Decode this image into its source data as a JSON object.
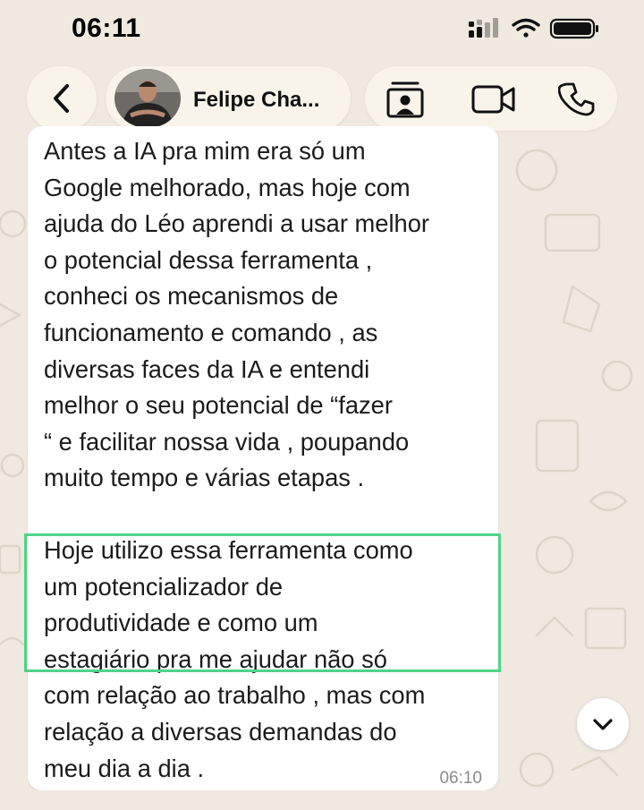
{
  "status_bar": {
    "time": "06:11",
    "icons": [
      "cellular-signal-icon",
      "wifi-icon",
      "battery-icon"
    ]
  },
  "header": {
    "back_icon": "chevron-left-icon",
    "contact_name": "Felipe Cha...",
    "actions": [
      "contact-card-icon",
      "video-call-icon",
      "phone-call-icon"
    ]
  },
  "message": {
    "paragraph_1": "Antes a IA pra mim era só um\nGoogle melhorado, mas hoje com\najuda do Léo aprendi a usar melhor\no potencial dessa ferramenta ,\nconheci os mecanismos de\nfuncionamento e comando , as\ndiversas faces da IA e entendi\nmelhor o seu potencial de “fazer\n“ e facilitar nossa vida , poupando\nmuito tempo e várias etapas .",
    "paragraph_2": "Hoje utilizo essa ferramenta como\num potencializador de\nprodutividade e como um\nestagiário pra me ajudar não só\ncom relação ao trabalho , mas com\nrelação a diversas demandas do\nmeu dia a dia .",
    "time": "06:10"
  },
  "scroll_button_icon": "chevron-down-icon",
  "colors": {
    "background": "#efe9df",
    "bubble": "#ffffff",
    "highlight": "#4fd389",
    "pill": "#f8f4ea"
  }
}
